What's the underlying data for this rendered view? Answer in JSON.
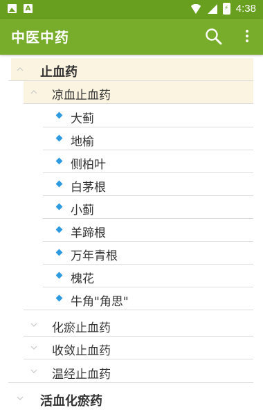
{
  "status_bar": {
    "time": "4:38",
    "battery_glyph": "⚡",
    "icons": [
      "image-icon",
      "a-icon",
      "wifi-icon",
      "signal-icon",
      "battery-icon"
    ]
  },
  "app_bar": {
    "title": "中医中药",
    "actions": [
      "search-icon",
      "overflow-menu-icon"
    ]
  },
  "tree": {
    "level1_top": {
      "label": "止血药",
      "expanded": true
    },
    "level2_open": {
      "label": "凉血止血药",
      "expanded": true
    },
    "items": [
      "大蓟",
      "地榆",
      "侧柏叶",
      "白茅根",
      "小蓟",
      "羊蹄根",
      "万年青根",
      "槐花",
      "牛角\"角思\""
    ],
    "level2_closed": [
      "化瘀止血药",
      "收敛止血药",
      "温经止血药"
    ],
    "level1_next": {
      "label": "活血化瘀药",
      "expanded": false
    }
  },
  "colors": {
    "status_bar": "#689f1f",
    "app_bar": "#77ad2b",
    "group_highlight": "#fbf4e1",
    "bullet": "#2e9be0"
  }
}
